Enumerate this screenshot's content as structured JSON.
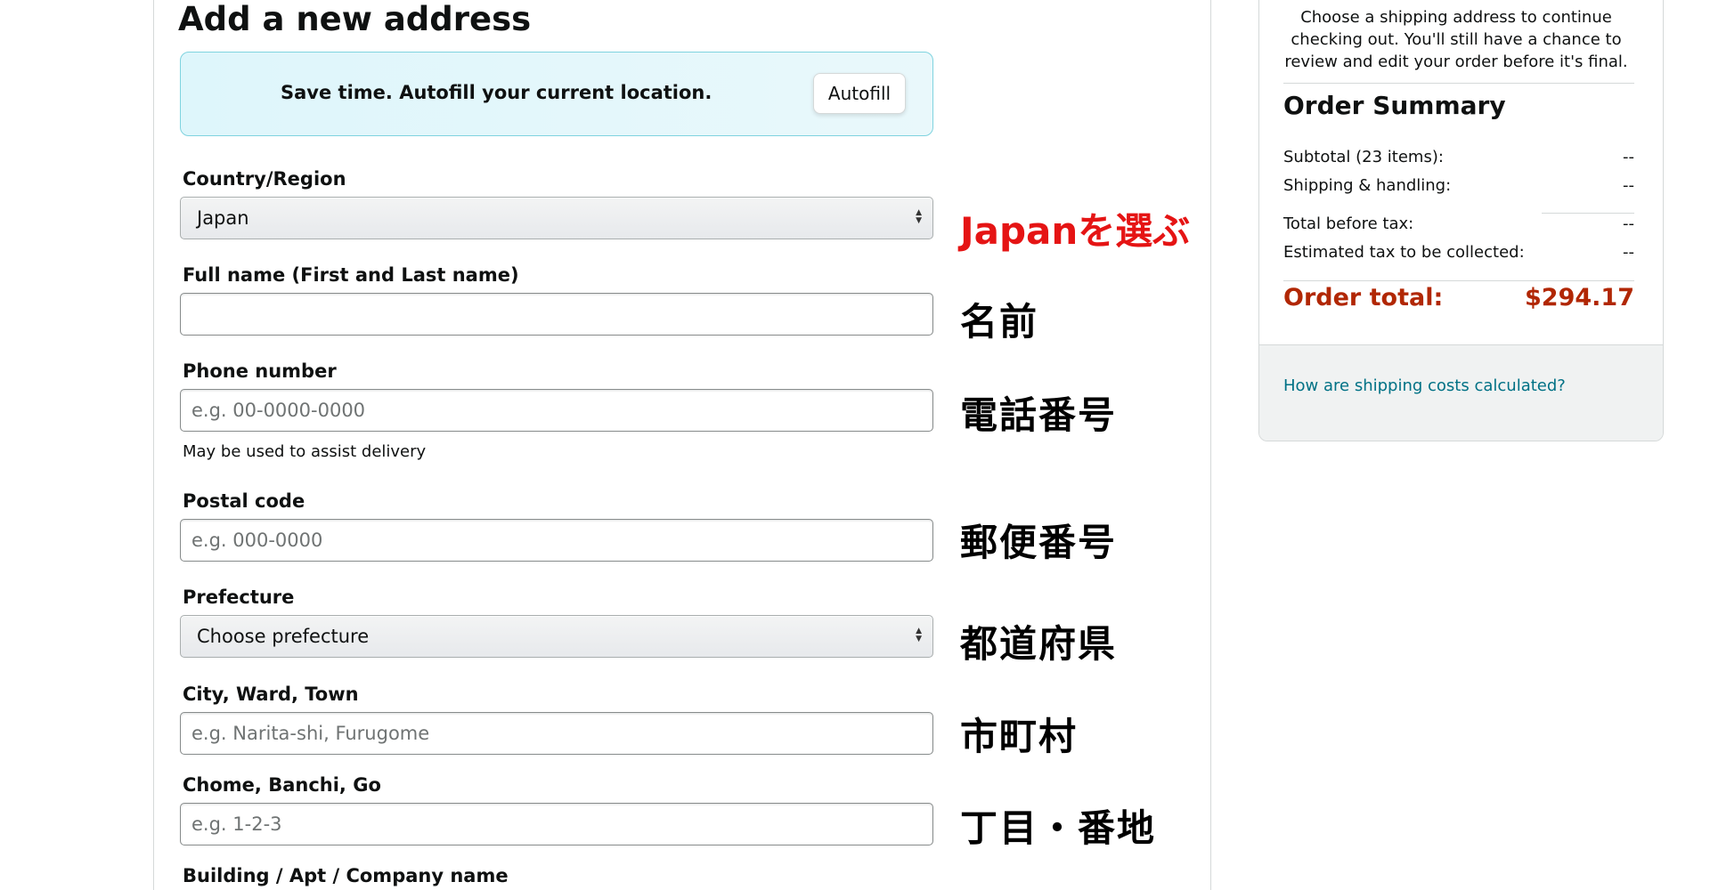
{
  "page": {
    "title": "Add a new address"
  },
  "autofill": {
    "text": "Save time. Autofill your current location.",
    "button_label": "Autofill"
  },
  "form": {
    "country": {
      "label": "Country/Region",
      "value": "Japan"
    },
    "full_name": {
      "label": "Full name (First and Last name)",
      "value": "",
      "placeholder": ""
    },
    "phone": {
      "label": "Phone number",
      "placeholder": "e.g. 00-0000-0000",
      "helper": "May be used to assist delivery"
    },
    "postal_code": {
      "label": "Postal code",
      "placeholder": "e.g. 000-0000"
    },
    "prefecture": {
      "label": "Prefecture",
      "value": "Choose prefecture"
    },
    "city": {
      "label": "City, Ward, Town",
      "placeholder": "e.g. Narita-shi, Furugome"
    },
    "chome": {
      "label": "Chome, Banchi, Go",
      "placeholder": "e.g. 1-2-3"
    },
    "building": {
      "label": "Building / Apt / Company name"
    }
  },
  "annotations": {
    "country": "Japanを選ぶ",
    "full_name": "名前",
    "phone": "電話番号",
    "postal_code": "郵便番号",
    "prefecture": "都道府県",
    "city": "市町村",
    "chome": "丁目・番地"
  },
  "summary": {
    "intro": "Choose a shipping address to continue checking out. You'll still have a chance to review and edit your order before it's final.",
    "title": "Order Summary",
    "subtotal_label": "Subtotal (23 items):",
    "subtotal_value": "--",
    "shipping_label": "Shipping & handling:",
    "shipping_value": "--",
    "before_tax_label": "Total before tax:",
    "before_tax_value": "--",
    "tax_label": "Estimated tax to be collected:",
    "tax_value": "--",
    "total_label": "Order total:",
    "total_value": "$294.17",
    "shipping_link": "How are shipping costs calculated?"
  },
  "colors": {
    "annotation_red": "#e51414",
    "order_total": "#b12704",
    "link": "#007185",
    "autofill_border": "#7fd3df"
  }
}
